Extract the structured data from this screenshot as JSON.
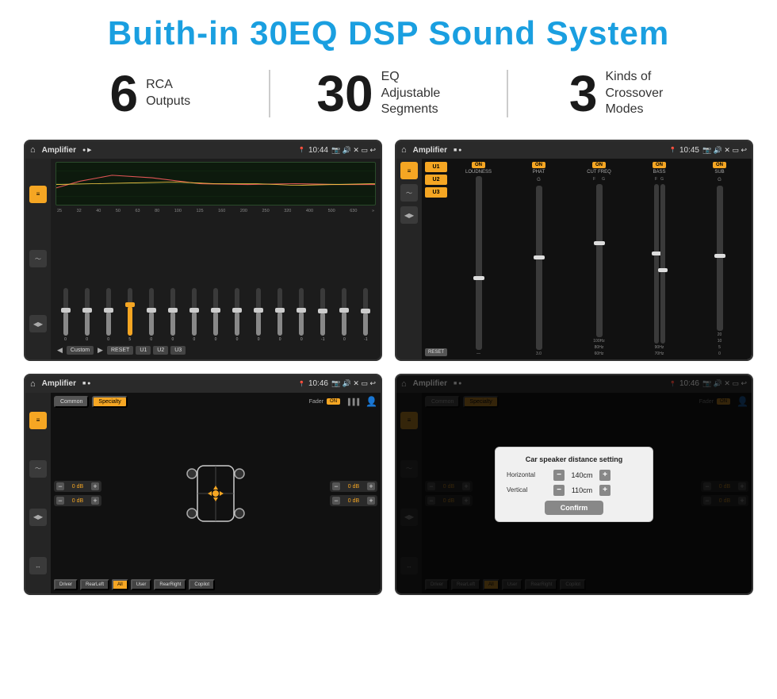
{
  "page": {
    "title": "Buith-in 30EQ DSP Sound System"
  },
  "stats": [
    {
      "number": "6",
      "label_line1": "RCA",
      "label_line2": "Outputs"
    },
    {
      "number": "30",
      "label_line1": "EQ Adjustable",
      "label_line2": "Segments"
    },
    {
      "number": "3",
      "label_line1": "Kinds of",
      "label_line2": "Crossover Modes"
    }
  ],
  "screens": {
    "screen1": {
      "status": {
        "title": "Amplifier",
        "time": "10:44"
      },
      "freq_labels": [
        "25",
        "32",
        "40",
        "50",
        "63",
        "80",
        "100",
        "125",
        "160",
        "200",
        "250",
        "320",
        "400",
        "500",
        "630"
      ],
      "slider_values": [
        "0",
        "0",
        "0",
        "5",
        "0",
        "0",
        "0",
        "0",
        "0",
        "0",
        "0",
        "0",
        "-1",
        "0",
        "-1"
      ],
      "buttons": [
        "Custom",
        "RESET",
        "U1",
        "U2",
        "U3"
      ]
    },
    "screen2": {
      "status": {
        "title": "Amplifier",
        "time": "10:45"
      },
      "u_buttons": [
        "U1",
        "U2",
        "U3"
      ],
      "channels": [
        "LOUDNESS",
        "PHAT",
        "CUT FREQ",
        "BASS",
        "SUB"
      ],
      "on_labels": [
        "ON",
        "ON",
        "ON",
        "ON",
        "ON"
      ]
    },
    "screen3": {
      "status": {
        "title": "Amplifier",
        "time": "10:46"
      },
      "tabs": [
        "Common",
        "Specialty"
      ],
      "fader_label": "Fader",
      "on_label": "ON",
      "vol_values": [
        "0 dB",
        "0 dB",
        "0 dB",
        "0 dB"
      ],
      "bottom_btns": [
        "Driver",
        "RearLeft",
        "All",
        "User",
        "RearRight",
        "Copilot"
      ]
    },
    "screen4": {
      "status": {
        "title": "Amplifier",
        "time": "10:46"
      },
      "tabs": [
        "Common",
        "Specialty"
      ],
      "dialog": {
        "title": "Car speaker distance setting",
        "horizontal_label": "Horizontal",
        "horizontal_val": "140cm",
        "vertical_label": "Vertical",
        "vertical_val": "110cm",
        "confirm_label": "Confirm",
        "db_label1": "0 dB",
        "db_label2": "0 dB"
      }
    }
  }
}
